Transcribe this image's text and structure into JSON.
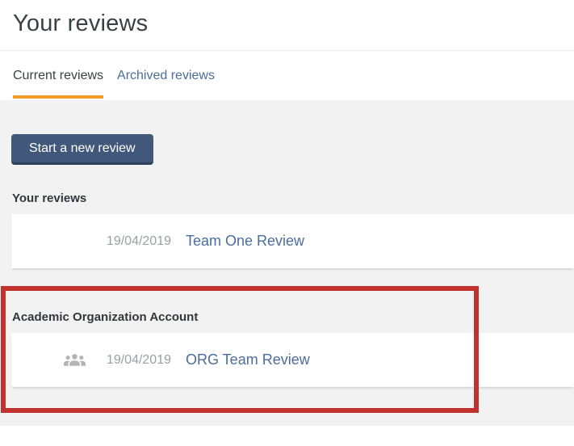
{
  "page": {
    "title": "Your reviews"
  },
  "tabs": [
    {
      "label": "Current reviews",
      "active": true
    },
    {
      "label": "Archived reviews",
      "active": false
    }
  ],
  "actions": {
    "start_review_label": "Start a new review"
  },
  "sections": [
    {
      "label": "Your reviews",
      "rows": [
        {
          "date": "19/04/2019",
          "title": "Team One Review",
          "icon": null
        }
      ]
    },
    {
      "label": "Academic Organization Account",
      "rows": [
        {
          "date": "19/04/2019",
          "title": "ORG Team Review",
          "icon": "group-icon"
        }
      ],
      "highlighted": true
    }
  ],
  "annotation": {
    "type": "highlight-box",
    "color": "#c0322e"
  },
  "colors": {
    "accent_orange": "#f09b26",
    "link_blue": "#4a6d9c",
    "button_navy": "#41587a",
    "button_navy_shadow": "#2e4158",
    "highlight_red": "#c0322e",
    "date_gray": "#9aa0a6",
    "icon_gray": "#b4b4b4",
    "content_bg_gray": "#f2f2f3",
    "heading_dark": "#3b3f46"
  }
}
